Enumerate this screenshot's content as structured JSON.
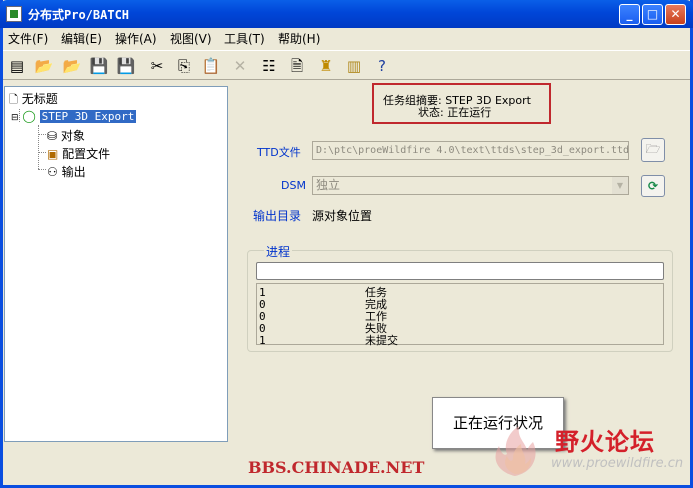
{
  "window": {
    "title": "分布式Pro/BATCH"
  },
  "menu": [
    "文件(F)",
    "编辑(E)",
    "操作(A)",
    "视图(V)",
    "工具(T)",
    "帮助(H)"
  ],
  "toolbar": {
    "icons": [
      "new-batch-icon",
      "open-folder-icon",
      "open-icon",
      "save-icon",
      "save-all-icon",
      "cut-icon",
      "copy-icon",
      "paste-icon",
      "delete-icon",
      "properties-icon",
      "document-icon",
      "execute-icon",
      "report-icon",
      "help-icon"
    ]
  },
  "tree": {
    "root": "无标题",
    "task": "STEP 3D Export",
    "children": [
      "对象",
      "配置文件",
      "输出"
    ]
  },
  "summary": {
    "line1": "任务组摘要: STEP 3D Export",
    "line2": "状态: 正在运行"
  },
  "form": {
    "ttd_label": "TTD文件",
    "ttd_value": "D:\\ptc\\proeWildfire 4.0\\text\\ttds\\step_3d_export.ttd",
    "dsm_label": "DSM",
    "dsm_value": "独立",
    "output_label": "输出目录",
    "output_value": "源对象位置"
  },
  "progress": {
    "title": "进程",
    "rows": [
      {
        "value": "1",
        "label": "任务"
      },
      {
        "value": "0",
        "label": "完成"
      },
      {
        "value": "0",
        "label": "工作"
      },
      {
        "value": "0",
        "label": "失败"
      },
      {
        "value": "1",
        "label": "未提交"
      }
    ]
  },
  "callout": "正在运行状况",
  "watermark": "BBS.CHINADE.NET",
  "logo": {
    "cn": "野火论坛",
    "url": "www.proewildfire.cn"
  },
  "colors": {
    "title_bar": "#0046d8",
    "selection": "#316ac5",
    "highlight_border": "#c0282d",
    "label_blue": "#0033cc"
  }
}
